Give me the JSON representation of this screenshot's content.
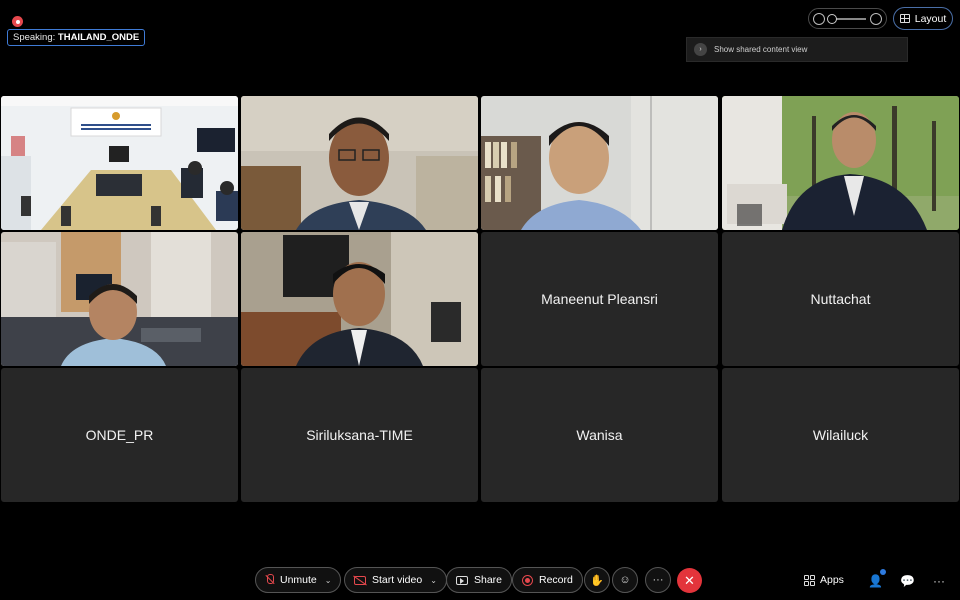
{
  "speaking": {
    "label": "Speaking:",
    "name": "THAILAND_ONDE"
  },
  "topbar": {
    "layout_label": "Layout",
    "shared_tip": "Show shared content view"
  },
  "video_tiles": [
    {
      "id": "tile-1-1",
      "kind": "video",
      "palette": [
        "#e9eef2",
        "#c9b66d",
        "#2e3a47"
      ]
    },
    {
      "id": "tile-1-2",
      "kind": "video",
      "palette": [
        "#c8c2b5",
        "#5c4e3d",
        "#26354a"
      ]
    },
    {
      "id": "tile-1-3",
      "kind": "video",
      "palette": [
        "#d9d9d6",
        "#6a5a4c",
        "#8fa7cf"
      ]
    },
    {
      "id": "tile-1-4",
      "kind": "video",
      "palette": [
        "#6b8f45",
        "#e4e1dc",
        "#1f2430"
      ]
    },
    {
      "id": "tile-2-1",
      "kind": "video",
      "palette": [
        "#cdb79a",
        "#c9c2ba",
        "#3b3f46"
      ]
    },
    {
      "id": "tile-2-2",
      "kind": "video",
      "palette": [
        "#b7ab98",
        "#2b2b2b",
        "#7b4b2f"
      ]
    }
  ],
  "name_tiles": [
    "Maneenut Pleansri",
    "Nuttachat",
    "ONDE_PR",
    "Siriluksana-TIME",
    "Wanisa",
    "Wilailuck"
  ],
  "controls": {
    "unmute": "Unmute",
    "start_video": "Start video",
    "share": "Share",
    "record": "Record",
    "apps": "Apps",
    "more": "···",
    "end_icon": "✕"
  }
}
